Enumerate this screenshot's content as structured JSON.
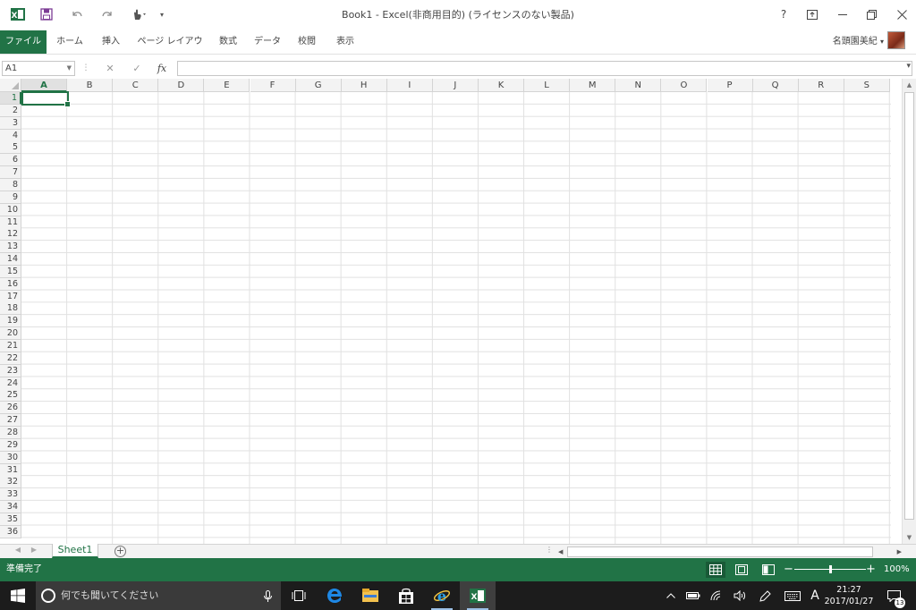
{
  "window": {
    "title": "Book1 - Excel(非商用目的) (ライセンスのない製品)",
    "help": "?",
    "minimize_icon": "minimize-icon",
    "restore_icon": "restore-icon",
    "close_icon": "close-icon"
  },
  "ribbon": {
    "file_tab": "ファイル",
    "tabs": [
      "ホーム",
      "挿入",
      "ページ レイアウト",
      "数式",
      "データ",
      "校閲",
      "表示"
    ],
    "user_name": "名頭園美紀",
    "user_dd": "▾"
  },
  "formula_bar": {
    "name_box": "A1",
    "cancel": "✕",
    "enter": "✓",
    "fx": "fx",
    "formula": ""
  },
  "grid": {
    "columns": [
      "A",
      "B",
      "C",
      "D",
      "E",
      "F",
      "G",
      "H",
      "I",
      "J",
      "K",
      "L",
      "M",
      "N",
      "O",
      "P",
      "Q",
      "R",
      "S"
    ],
    "rows": [
      "1",
      "2",
      "3",
      "4",
      "5",
      "6",
      "7",
      "8",
      "9",
      "10",
      "11",
      "12",
      "13",
      "14",
      "15",
      "16",
      "17",
      "18",
      "19",
      "20",
      "21",
      "22",
      "23",
      "24",
      "25",
      "26",
      "27",
      "28",
      "29",
      "30",
      "31",
      "32",
      "33",
      "34",
      "35",
      "36"
    ],
    "active_cell": "A1"
  },
  "sheets": {
    "tabs": [
      "Sheet1"
    ],
    "add": "+"
  },
  "status": {
    "text": "準備完了",
    "zoom_minus": "−",
    "zoom_plus": "+",
    "zoom": "100%",
    "zoom_fraction": 0.5
  },
  "taskbar": {
    "search_placeholder": "何でも聞いてください",
    "ime": "A",
    "time": "21:27",
    "date": "2017/01/27",
    "notifications": "13"
  },
  "colors": {
    "accent": "#217346",
    "taskbar": "#1c1c1c"
  }
}
